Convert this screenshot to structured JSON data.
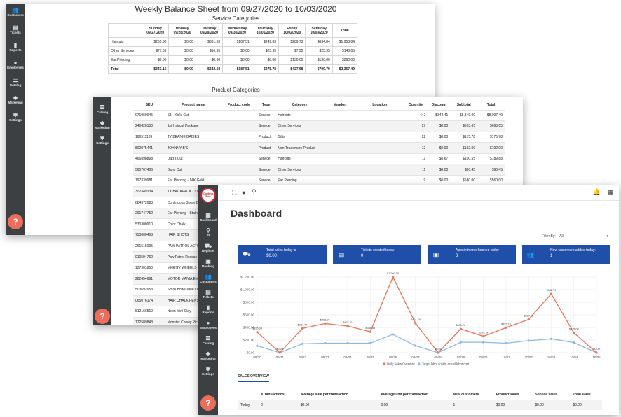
{
  "sidebar_items": {
    "customers": "Customers",
    "tickets": "Tickets",
    "reports": "Reports",
    "employees": "Employees",
    "catalog": "Catalog",
    "marketing": "Marketing",
    "settings": "Settings",
    "dashboard": "Dashboard",
    "register": "Register",
    "booking": "Booking",
    "si": "SI"
  },
  "balance": {
    "title": "Weekly Balance Sheet from 09/27/2020 to 10/03/2020",
    "service_title": "Service Categories",
    "product_title": "Product Categories",
    "days": [
      {
        "name": "Sunday",
        "date": "09/27/2020"
      },
      {
        "name": "Monday",
        "date": "09/28/2020"
      },
      {
        "name": "Tuesday",
        "date": "09/29/2020"
      },
      {
        "name": "Wednesday",
        "date": "09/30/2020"
      },
      {
        "name": "Thursday",
        "date": "10/01/2020"
      },
      {
        "name": "Friday",
        "date": "10/02/2020"
      },
      {
        "name": "Saturday",
        "date": "10/03/2020"
      }
    ],
    "total_header": "Total",
    "rows": [
      {
        "label": "Haircuts",
        "values": [
          "$265.30",
          "$0.00",
          "$331.63",
          "$187.51",
          "$249.83",
          "$289.73",
          "$634.84",
          "$1,958.84"
        ]
      },
      {
        "label": "Other Services",
        "values": [
          "$77.85",
          "$0.00",
          "$10.95",
          "$0.00",
          "$25.95",
          "$7.95",
          "$25.95",
          "$148.65"
        ]
      },
      {
        "label": "Ear Piercing",
        "values": [
          "$0.00",
          "$0.00",
          "$0.00",
          "$0.00",
          "$0.00",
          "$130.00",
          "$130.00",
          "$260.00"
        ]
      },
      {
        "label": "Total",
        "values": [
          "$343.15",
          "$0.00",
          "$342.58",
          "$187.51",
          "$275.78",
          "$427.68",
          "$790.79",
          "$2,367.49"
        ]
      }
    ]
  },
  "products": {
    "headers": [
      "SKU",
      "Product name",
      "Product code",
      "Type",
      "Category",
      "Vendor",
      "Location",
      "Quantity",
      "Discount",
      "Subtotal",
      "Total"
    ],
    "rows": [
      [
        "971969045",
        "S1 - Kid's Cut",
        "",
        "Service",
        "Haircuts",
        "",
        "",
        "442",
        "$342.41",
        "$8,349.90",
        "$8,007.49"
      ],
      [
        "240428130",
        "1st Haircut Package",
        "",
        "Service",
        "Other Services",
        "",
        "",
        "27",
        "$0.00",
        "$693.65",
        "$693.65"
      ],
      [
        "166511189",
        "TY BEANIE BABIES",
        "",
        "Product",
        "Gifts",
        "",
        "",
        "22",
        "$0.00",
        "$175.78",
        "$175.78"
      ],
      [
        "802075441",
        "JOHNNY B'S",
        "",
        "Product",
        "Non-Trademark Product",
        "",
        "",
        "12",
        "$0.00",
        "$192.00",
        "$192.00"
      ],
      [
        "466898898",
        "Dad's Cut",
        "",
        "Service",
        "Haircuts",
        "",
        "",
        "11",
        "$0.67",
        "$190.55",
        "$189.88"
      ],
      [
        "565767406",
        "Bang Cut",
        "",
        "Service",
        "Other Services",
        "",
        "",
        "11",
        "$0.00",
        "$90.45",
        "$90.45"
      ],
      [
        "197339981",
        "Ear Piercing - 14K Gold",
        "",
        "Service",
        "Ear Piercing",
        "",
        "",
        "9",
        "$0.00",
        "$560.00",
        "$560.00"
      ],
      [
        "302349334",
        "TY BACKPACK CLIPS",
        "",
        "",
        "",
        "",
        "",
        "",
        "",
        "",
        ""
      ],
      [
        "884372683",
        "Continuous Spray Bo",
        "",
        "",
        "",
        "",
        "",
        "",
        "",
        "",
        ""
      ],
      [
        "291747752",
        "Ear Piercing - Stainle",
        "",
        "",
        "",
        "",
        "",
        "",
        "",
        "",
        ""
      ],
      [
        "530300910",
        "Color Chalk",
        "",
        "",
        "",
        "",
        "",
        "",
        "",
        "",
        ""
      ],
      [
        "753000403",
        "HAIR SHOTS",
        "",
        "",
        "",
        "",
        "",
        "",
        "",
        "",
        ""
      ],
      [
        "261515095",
        "PAW PATROL ACTIO",
        "",
        "",
        "",
        "",
        "",
        "",
        "",
        "",
        ""
      ],
      [
        "910594762",
        "Paw Patrol Rescue R",
        "",
        "",
        "",
        "",
        "",
        "",
        "",
        "",
        ""
      ],
      [
        "137901850",
        "MIGHTY WHEELS",
        "",
        "",
        "",
        "",
        "",
        "",
        "",
        "",
        ""
      ],
      [
        "282454691",
        "MOTOR MANIA EMS",
        "",
        "",
        "",
        "",
        "",
        "",
        "",
        "",
        ""
      ],
      [
        "503692653",
        "Small Bows-Wee Oni",
        "",
        "",
        "",
        "",
        "",
        "",
        "",
        "",
        ""
      ],
      [
        "065076174",
        "HAIR CHALK PENS",
        "",
        "",
        "",
        "",
        "",
        "",
        "",
        "",
        ""
      ],
      [
        "512166519",
        "Neon Mini Clay",
        "",
        "",
        "",
        "",
        "",
        "",
        "",
        "",
        ""
      ],
      [
        "172589843",
        "Monster Chewy Picku",
        "",
        "",
        "",
        "",
        "",
        "",
        "",
        "",
        ""
      ]
    ]
  },
  "dashboard": {
    "title": "Dashboard",
    "logo_text": "Cutting Fun",
    "filter_label": "Filter By:",
    "filter_value": "All",
    "cards": [
      {
        "label": "Total sales today is",
        "value": "$0.00",
        "icon": "cart-icon"
      },
      {
        "label": "Tickets created today",
        "value": "0",
        "icon": "ticket-icon"
      },
      {
        "label": "Appointments booked today",
        "value": "3",
        "icon": "calendar-icon"
      },
      {
        "label": "New customers added today:",
        "value": "1",
        "icon": "people-icon"
      }
    ],
    "tab": "SALES OVERVIEW",
    "sales_headers": [
      "",
      "#Transactions",
      "Average sale per transaction",
      "",
      "Average unit per transaction",
      "New customers",
      "Product sales",
      "Service sales",
      "Total sales"
    ],
    "sales_row": [
      "Today",
      "0",
      "$0.00",
      "",
      "0.00",
      "1",
      "$0.00",
      "$0.00",
      "$0.00"
    ]
  },
  "chart_data": {
    "type": "line",
    "x": [
      "09/20",
      "09/21",
      "09/22",
      "09/23",
      "09/24",
      "09/25",
      "09/26",
      "09/27",
      "09/28",
      "09/29",
      "09/30",
      "10/01",
      "10/02",
      "10/03",
      "10/04",
      "10/05"
    ],
    "yticks": [
      "$1,200.00",
      "$1,000.00",
      "$800.00",
      "$600.00",
      "$400.00",
      "$200.00",
      "$0.00"
    ],
    "ylim": [
      0,
      1200
    ],
    "series": [
      {
        "name": "Daily Sales Overview",
        "color": "#e8735a",
        "values": [
          325.34,
          0,
          384.72,
          461.95,
          422.21,
          331.63,
          1200,
          464.78,
          0,
          375.78,
          259.74,
          397.18,
          527.18,
          932.79,
          315.08,
          0
        ]
      },
      {
        "name": "Target labor cost in actual labor cost",
        "color": "#8fb8e0",
        "values": [
          110,
          0,
          140,
          150,
          150,
          150,
          290,
          110,
          0,
          165,
          165,
          150,
          190,
          220,
          160,
          0
        ]
      }
    ],
    "point_labels": [
      "$325.34",
      "$0.00",
      "$384.72",
      "$461.95",
      "$422.21",
      "$331.63",
      "$1,200.00",
      "$464.78",
      "$0.00",
      "$375.78",
      "$259.74",
      "$397.18",
      "$527.18",
      "$932.79",
      "$315.08",
      "$0.00"
    ],
    "grid": true,
    "legend": "bottom"
  }
}
